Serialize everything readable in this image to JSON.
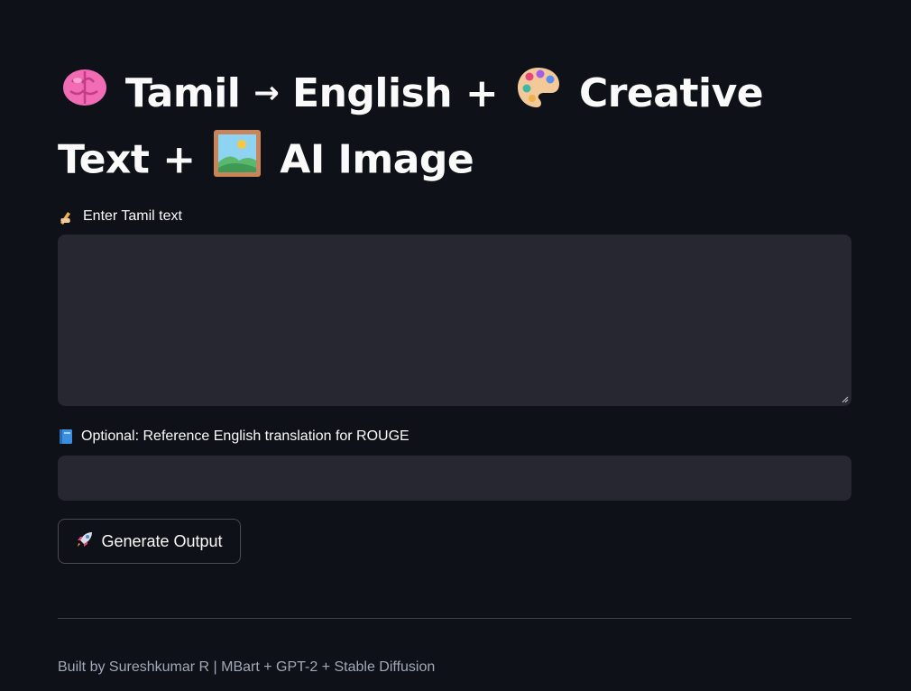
{
  "title": {
    "part1": "Tamil",
    "arrow": "→",
    "part2": "English +",
    "part3": "Creative",
    "part4": "Text +",
    "part5": "AI Image"
  },
  "tamil_input": {
    "label": "Enter Tamil text",
    "value": ""
  },
  "reference_input": {
    "label": "Optional: Reference English translation for ROUGE",
    "value": ""
  },
  "generate_button": {
    "label": "Generate Output"
  },
  "footer": {
    "text": "Built by Sureshkumar R | MBart + GPT-2 + Stable Diffusion"
  },
  "colors": {
    "background": "#0e1117",
    "input_background": "#262730",
    "text": "#fafafa",
    "muted": "#a3a8b8"
  },
  "icons": [
    "brain-icon",
    "palette-icon",
    "framed-picture-icon",
    "writing-hand-icon",
    "blue-book-icon",
    "rocket-icon"
  ]
}
